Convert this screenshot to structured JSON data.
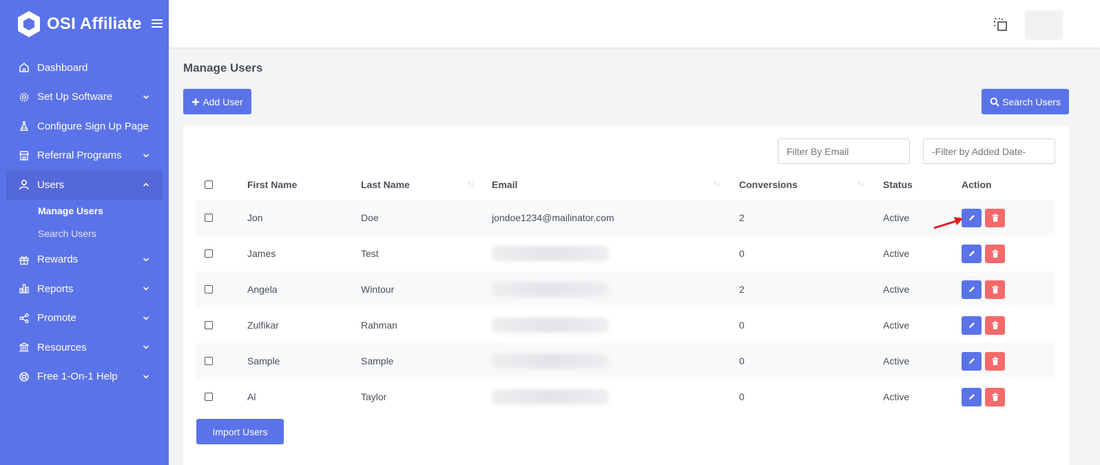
{
  "app": {
    "name": "OSI Affiliate"
  },
  "sidebar": {
    "items": [
      {
        "label": "Dashboard",
        "icon": "home-icon",
        "has_children": false
      },
      {
        "label": "Set Up Software",
        "icon": "gear-icon",
        "has_children": true
      },
      {
        "label": "Configure Sign Up Page",
        "icon": "flask-icon",
        "has_children": false
      },
      {
        "label": "Referral Programs",
        "icon": "store-icon",
        "has_children": true
      },
      {
        "label": "Users",
        "icon": "user-icon",
        "has_children": true,
        "expanded": true
      },
      {
        "label": "Rewards",
        "icon": "gift-icon",
        "has_children": true
      },
      {
        "label": "Reports",
        "icon": "bar-chart-icon",
        "has_children": true
      },
      {
        "label": "Promote",
        "icon": "share-icon",
        "has_children": true
      },
      {
        "label": "Resources",
        "icon": "bank-icon",
        "has_children": true
      },
      {
        "label": "Free 1-On-1 Help",
        "icon": "lifebuoy-icon",
        "has_children": true
      }
    ],
    "users_submenu": [
      {
        "label": "Manage Users",
        "current": true
      },
      {
        "label": "Search Users",
        "current": false
      }
    ]
  },
  "page": {
    "title": "Manage Users",
    "add_user_label": "Add User",
    "search_users_label": "Search Users",
    "import_users_label": "Import Users",
    "filter_email_placeholder": "Filter By Email",
    "filter_date_placeholder": "-Filter by Added Date-"
  },
  "table": {
    "columns": [
      "First Name",
      "Last Name",
      "Email",
      "Conversions",
      "Status",
      "Action"
    ],
    "rows": [
      {
        "first": "Jon",
        "last": "Doe",
        "email": "jondoe1234@mailinator.com",
        "email_redacted": false,
        "conversions": "2",
        "status": "Active"
      },
      {
        "first": "James",
        "last": "Test",
        "email": "",
        "email_redacted": true,
        "conversions": "0",
        "status": "Active"
      },
      {
        "first": "Angela",
        "last": "Wintour",
        "email": "",
        "email_redacted": true,
        "conversions": "2",
        "status": "Active"
      },
      {
        "first": "Zulfikar",
        "last": "Rahman",
        "email": "",
        "email_redacted": true,
        "conversions": "0",
        "status": "Active"
      },
      {
        "first": "Sample",
        "last": "Sample",
        "email": "",
        "email_redacted": true,
        "conversions": "0",
        "status": "Active"
      },
      {
        "first": "Al",
        "last": "Taylor",
        "email": "",
        "email_redacted": true,
        "conversions": "0",
        "status": "Active"
      }
    ]
  },
  "colors": {
    "sidebar_bg": "#5b73e8",
    "primary": "#5b73e8",
    "danger": "#f46a6a",
    "annotation_arrow": "#e31b1b"
  }
}
